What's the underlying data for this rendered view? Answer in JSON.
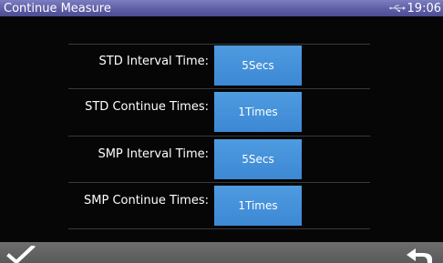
{
  "window": {
    "title": "Continue Measure",
    "time": "19:06"
  },
  "settings": [
    {
      "label": "STD Interval Time:",
      "value": "5Secs"
    },
    {
      "label": "STD Continue Times:",
      "value": "1Times"
    },
    {
      "label": "SMP Interval Time:",
      "value": "5Secs"
    },
    {
      "label": "SMP Continue Times:",
      "value": "1Times"
    }
  ],
  "icons": {
    "status": "usb-icon",
    "confirm": "check-icon",
    "back": "back-arrow-icon"
  },
  "colors": {
    "title_bar": "#5e5ea6",
    "value_button": "#4290d8",
    "bottom_bar": "#636363",
    "background": "#060606"
  }
}
